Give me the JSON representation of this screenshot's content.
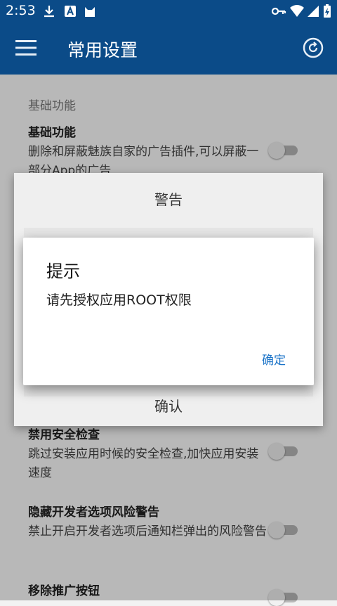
{
  "status_bar": {
    "time": "2:53"
  },
  "app_bar": {
    "title": "常用设置"
  },
  "content": {
    "section_label": "基础功能",
    "settings": [
      {
        "title": "基础功能",
        "description": "删除和屏蔽魅族自家的广告插件,可以屏蔽一部分App的广告",
        "enabled": false
      },
      {
        "title": "禁用安全检查",
        "description": "跳过安装应用时候的安全检查,加快应用安装速度",
        "enabled": false
      },
      {
        "title": "隐藏开发者选项风险警告",
        "description": "禁止开启开发者选项后通知栏弹出的风险警告",
        "enabled": false
      },
      {
        "title": "移除推广按钮",
        "description": "",
        "enabled": false
      }
    ]
  },
  "warning_dialog": {
    "title": "警告",
    "confirm_label": "确认"
  },
  "alert_dialog": {
    "title": "提示",
    "message": "请先授权应用ROOT权限",
    "ok_label": "确定"
  },
  "colors": {
    "app_bar": "#0b4b88",
    "accent": "#1a73c8"
  }
}
